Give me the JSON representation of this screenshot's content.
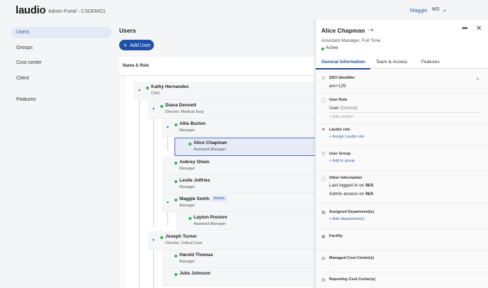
{
  "header": {
    "brand": "laudio",
    "subtitle": "Admin Portal - CSDEMO1",
    "user_name": "Maggie",
    "user_initials": "MS",
    "chevron_icon": "chevron-down-icon"
  },
  "sidebar": {
    "items": [
      {
        "label": "Users",
        "active": true
      },
      {
        "label": "Groups"
      },
      {
        "label": "Cost center"
      },
      {
        "label": "Client"
      },
      {
        "label": "Features"
      }
    ]
  },
  "users": {
    "title": "Users",
    "add_button": "Add User",
    "column_header": "Name & Role",
    "rows": [
      {
        "name": "Kathy Hernandez",
        "title": "CNO"
      },
      {
        "name": "Diana Dennett",
        "title": "Director, Medical Surg"
      },
      {
        "name": "Allie Burton",
        "title": "Manager"
      },
      {
        "name": "Alice Chapman",
        "title": "Assistant Manager"
      },
      {
        "name": "Aubrey Olsen",
        "title": "Manager"
      },
      {
        "name": "Leslie Jeffries",
        "title": "Manager"
      },
      {
        "name": "Maggie Smith",
        "title": "Manager",
        "badge": "Admin"
      },
      {
        "name": "Layton Preston",
        "title": "Assistant Manager"
      },
      {
        "name": "Joseph Turner",
        "title": "Director, Critical Care"
      },
      {
        "name": "Harold Thomas",
        "title": "Manager"
      },
      {
        "name": "Julie Johnson",
        "title": ""
      }
    ]
  },
  "detail": {
    "name": "Alice Chapman",
    "subtitle": "Assistant Manager, Full Time",
    "status": "Active",
    "tabs": [
      "General Information",
      "Team & Access",
      "Features"
    ],
    "sections": {
      "sso_label": "SSO Identifier",
      "sso_value": "am+125",
      "role_label": "User Role",
      "role_value": "User",
      "role_default": "(Default)",
      "add_another": "+ Add another",
      "laudio_role_label": "Laudio role",
      "assign_role": "+ Assign Laudio role",
      "group_label": "User Group",
      "add_group": "+ Add to group",
      "other_label": "Other Information",
      "last_logged_label": "Last logged in on",
      "last_logged_value": "N/A",
      "admin_access_label": "Admin access on",
      "admin_access_value": "N/A",
      "dept_label": "Assigned Department(s)",
      "add_dept": "+ Add department(s)",
      "facility_label": "Facility",
      "facility_value": "-",
      "managed_cc_label": "Managed Cost Center(s)",
      "managed_cc_value": "-",
      "reporting_cc_label": "Reporting Cost Center(s)"
    }
  },
  "colors": {
    "accent": "#1f4fa8",
    "link": "#2f5fb3",
    "active_dot": "#2fb34a",
    "selected_row": "#e6ebf7"
  }
}
